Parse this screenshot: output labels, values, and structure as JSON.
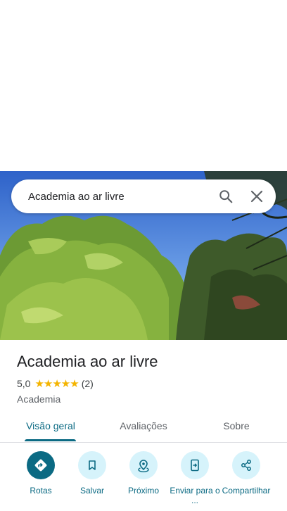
{
  "search": {
    "query": "Academia ao ar livre"
  },
  "place": {
    "title": "Academia ao ar livre",
    "rating": "5,0",
    "stars": "★★★★★",
    "review_count": "(2)",
    "category": "Academia"
  },
  "tabs": [
    {
      "label": "Visão geral",
      "active": true
    },
    {
      "label": "Avaliações",
      "active": false
    },
    {
      "label": "Sobre",
      "active": false
    }
  ],
  "actions": [
    {
      "label": "Rotas",
      "icon": "directions-icon"
    },
    {
      "label": "Salvar",
      "icon": "bookmark-icon"
    },
    {
      "label": "Próximo",
      "icon": "nearby-icon"
    },
    {
      "label": "Enviar para o ...",
      "icon": "send-to-phone-icon"
    },
    {
      "label": "Compartilhar",
      "icon": "share-icon"
    }
  ],
  "colors": {
    "accent": "#0b6a83",
    "action_bg": "#d6f3fb",
    "star": "#f4b400"
  }
}
